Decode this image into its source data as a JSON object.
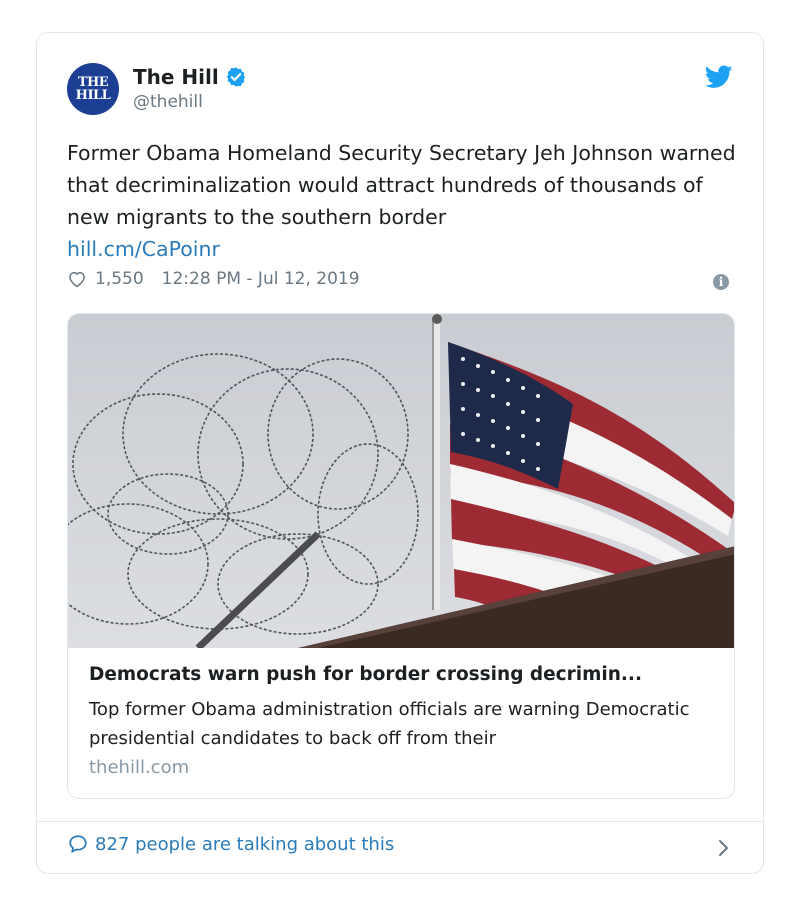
{
  "author": {
    "avatar_line1": "THE",
    "avatar_line2": "HILL",
    "name": "The Hill",
    "handle": "@thehill"
  },
  "tweet": {
    "text": "Former Obama Homeland Security Secretary Jeh Johnson warned that decriminalization would attract hundreds of thousands of new migrants to the southern border",
    "link": "hill.cm/CaPoinr",
    "likes": "1,550",
    "timestamp": "12:28 PM - Jul 12, 2019"
  },
  "link_card": {
    "title": "Democrats warn push for border crossing decrimin...",
    "description": "Top former Obama administration officials are warning Democratic presidential candidates to back off from their",
    "domain": "thehill.com"
  },
  "footer": {
    "talk_text": "827 people are talking about this"
  },
  "colors": {
    "accent": "#1da1f2",
    "link": "#2b7bb9",
    "muted": "#697882",
    "avatar_bg": "#1c3f94"
  },
  "icons": [
    "verified-icon",
    "twitter-bird-icon",
    "heart-icon",
    "info-icon",
    "comment-bubble-icon",
    "chevron-right-icon"
  ]
}
